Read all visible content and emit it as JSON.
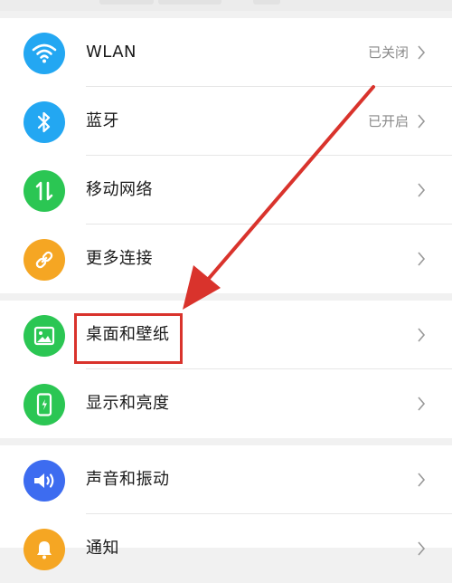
{
  "settings": {
    "group1": [
      {
        "label": "WLAN",
        "status": "已关闭",
        "icon": "wifi-icon",
        "color": "#23a7f2"
      },
      {
        "label": "蓝牙",
        "status": "已开启",
        "icon": "bluetooth-icon",
        "color": "#23a7f2"
      },
      {
        "label": "移动网络",
        "status": "",
        "icon": "mobile-data-icon",
        "color": "#2bc653"
      },
      {
        "label": "更多连接",
        "status": "",
        "icon": "link-icon",
        "color": "#f5a623"
      }
    ],
    "group2": [
      {
        "label": "桌面和壁纸",
        "icon": "image-icon",
        "color": "#2bc653"
      },
      {
        "label": "显示和亮度",
        "icon": "phone-brightness-icon",
        "color": "#2bc653"
      }
    ],
    "group3": [
      {
        "label": "声音和振动",
        "icon": "speaker-icon",
        "color": "#3d6cf0"
      },
      {
        "label": "通知",
        "icon": "bell-icon",
        "color": "#f5a623"
      }
    ]
  },
  "annotation": {
    "color": "#d9332c"
  }
}
